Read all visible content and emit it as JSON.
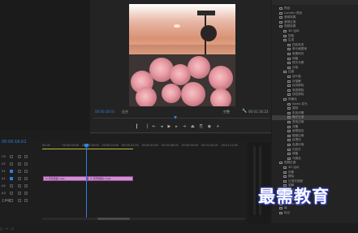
{
  "monitor": {
    "timecode_current": "00:00:16:01",
    "fit_label": "适合",
    "full_label": "完整",
    "wrench_icon": "wrench-icon",
    "timecode_total": "00:01:16:23",
    "transport": [
      {
        "icon": "mark-in-icon",
        "glyph": "▎"
      },
      {
        "icon": "mark-out-icon",
        "glyph": "▕"
      },
      {
        "icon": "go-to-in-icon",
        "glyph": "⇤"
      },
      {
        "icon": "step-back-icon",
        "glyph": "◂"
      },
      {
        "icon": "play-icon",
        "glyph": "▶"
      },
      {
        "icon": "step-forward-icon",
        "glyph": "▸"
      },
      {
        "icon": "go-to-out-icon",
        "glyph": "⇥"
      },
      {
        "icon": "lift-icon",
        "glyph": "⏏"
      },
      {
        "icon": "extract-icon",
        "glyph": "⎘"
      },
      {
        "icon": "export-frame-icon",
        "glyph": "◉"
      },
      {
        "icon": "add-button-icon",
        "glyph": "+"
      }
    ]
  },
  "effects": {
    "items": [
      {
        "label": "预设",
        "indent": 1,
        "selected": false
      },
      {
        "label": "Lumetri 预设",
        "indent": 1,
        "selected": false
      },
      {
        "label": "音频效果",
        "indent": 1,
        "selected": false
      },
      {
        "label": "音频过渡",
        "indent": 1,
        "selected": false
      },
      {
        "label": "视频效果",
        "indent": 1,
        "selected": false
      },
      {
        "label": "3D 运动",
        "indent": 2,
        "selected": false
      },
      {
        "label": "扭曲",
        "indent": 2,
        "selected": false
      },
      {
        "label": "生成",
        "indent": 2,
        "selected": false
      },
      {
        "label": "四色渐变",
        "indent": 3,
        "selected": false
      },
      {
        "label": "单元格图案",
        "indent": 3,
        "selected": false
      },
      {
        "label": "吸管填充",
        "indent": 3,
        "selected": false
      },
      {
        "label": "网格",
        "indent": 3,
        "selected": false
      },
      {
        "label": "镜头光晕",
        "indent": 3,
        "selected": false
      },
      {
        "label": "闪电",
        "indent": 3,
        "selected": false
      },
      {
        "label": "过渡",
        "indent": 2,
        "selected": false
      },
      {
        "label": "百叶窗",
        "indent": 3,
        "selected": false
      },
      {
        "label": "块溶解",
        "indent": 3,
        "selected": false
      },
      {
        "label": "径向擦除",
        "indent": 3,
        "selected": false
      },
      {
        "label": "渐变擦除",
        "indent": 3,
        "selected": false
      },
      {
        "label": "线性擦除",
        "indent": 3,
        "selected": false
      },
      {
        "label": "风格化",
        "indent": 2,
        "selected": false
      },
      {
        "label": "Alpha 发光",
        "indent": 3,
        "selected": false
      },
      {
        "label": "复制",
        "indent": 3,
        "selected": false
      },
      {
        "label": "彩色浮雕",
        "indent": 3,
        "selected": false
      },
      {
        "label": "曝光过度",
        "indent": 3,
        "selected": true
      },
      {
        "label": "查找边缘",
        "indent": 3,
        "selected": false
      },
      {
        "label": "浮雕",
        "indent": 3,
        "selected": false
      },
      {
        "label": "画笔描边",
        "indent": 3,
        "selected": false
      },
      {
        "label": "粗糙边缘",
        "indent": 3,
        "selected": false
      },
      {
        "label": "纹理化",
        "indent": 3,
        "selected": false
      },
      {
        "label": "色调分离",
        "indent": 3,
        "selected": false
      },
      {
        "label": "闪光灯",
        "indent": 3,
        "selected": false
      },
      {
        "label": "阈值",
        "indent": 3,
        "selected": false
      },
      {
        "label": "马赛克",
        "indent": 3,
        "selected": false
      },
      {
        "label": "视频过渡",
        "indent": 1,
        "selected": false
      },
      {
        "label": "3D 运动",
        "indent": 2,
        "selected": false
      },
      {
        "label": "划像",
        "indent": 2,
        "selected": false
      },
      {
        "label": "擦除",
        "indent": 2,
        "selected": false
      },
      {
        "label": "沉浸式视频",
        "indent": 2,
        "selected": false
      },
      {
        "label": "溶解",
        "indent": 2,
        "selected": false
      },
      {
        "label": "滑动",
        "indent": 2,
        "selected": false
      },
      {
        "label": "缩放",
        "indent": 2,
        "selected": false
      },
      {
        "label": "页面剥落",
        "indent": 2,
        "selected": false
      },
      {
        "label": "Lumetri 颜色",
        "indent": 1,
        "selected": false
      },
      {
        "label": "库",
        "indent": 1,
        "selected": false
      },
      {
        "label": "标记",
        "indent": 1,
        "selected": false
      }
    ]
  },
  "timeline": {
    "timecode": "00:00:16:01",
    "ruler_ticks": [
      "00:00",
      "00:00:08:00",
      "00:00:16:00",
      "00:00:24:00",
      "00:00:32:00",
      "00:00:40:00",
      "00:00:48:00",
      "00:00:56:00",
      "00:01:04:00",
      "00:01:12:00"
    ],
    "tracks": [
      {
        "label": "V3",
        "on": false
      },
      {
        "label": "V2",
        "on": false
      },
      {
        "label": "V1",
        "on": true
      },
      {
        "label": "A1",
        "on": true
      },
      {
        "label": "A2",
        "on": false
      },
      {
        "label": "A3",
        "on": false
      },
      {
        "label": "主声道",
        "on": false
      }
    ],
    "clip_1_label": "fx 风景视频.mp4",
    "clip_2_label": "fx 风景视频2.mp4"
  },
  "watermark": "最需教育"
}
